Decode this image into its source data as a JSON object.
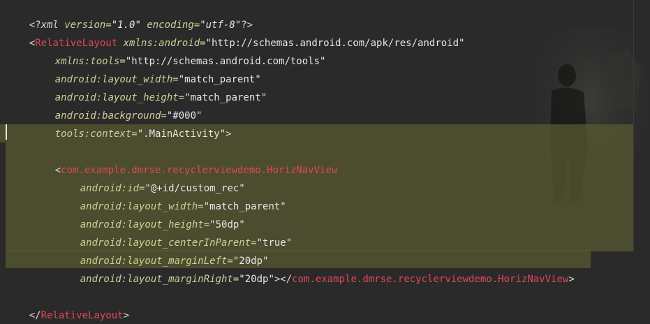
{
  "editor": {
    "line1": {
      "open": "<?",
      "xml": "xml",
      "version_key": " version=",
      "version_val": "\"1.0\"",
      "encoding_key": " encoding=",
      "encoding_val": "\"utf-8\"",
      "close": "?>"
    },
    "line2": {
      "lt": "<",
      "tag": "RelativeLayout",
      "attr": " xmlns:android=",
      "val": "\"http://schemas.android.com/apk/res/android\""
    },
    "line3": {
      "attr": "xmlns:tools=",
      "val": "\"http://schemas.android.com/tools\""
    },
    "line4": {
      "attr": "android:layout_width=",
      "val": "\"match_parent\""
    },
    "line5": {
      "attr": "android:layout_height=",
      "val": "\"match_parent\""
    },
    "line6": {
      "attr": "android:background=",
      "val": "\"#000\""
    },
    "line7": {
      "attr": "tools:context=",
      "val": "\".MainActivity\"",
      "close": ">"
    },
    "line9": {
      "lt": "<",
      "tag": "com.example.dmrse.recyclerviewdemo.HorizNavView"
    },
    "line10": {
      "attr": "android:id=",
      "val": "\"@+id/custom_rec\""
    },
    "line11": {
      "attr": "android:layout_width=",
      "val": "\"match_parent\""
    },
    "line12": {
      "attr": "android:layout_height=",
      "val": "\"50dp\""
    },
    "line13": {
      "attr": "android:layout_centerInParent=",
      "val": "\"true\""
    },
    "line14": {
      "attr": "android:layout_marginLeft=",
      "val": "\"20dp\""
    },
    "line15": {
      "attr": "android:layout_marginRight=",
      "val": "\"20dp\"",
      "mid": "></",
      "tag": "com.example.dmrse.recyclerviewdemo.HorizNavView",
      "close": ">"
    },
    "line17": {
      "lt": "</",
      "tag": "RelativeLayout",
      "close": ">"
    }
  },
  "colors": {
    "background": "#2a2a2a",
    "tag": "#e0475b",
    "attribute": "#cfcf9a",
    "value": "#e6e6e6",
    "selection": "#5a5a30"
  }
}
